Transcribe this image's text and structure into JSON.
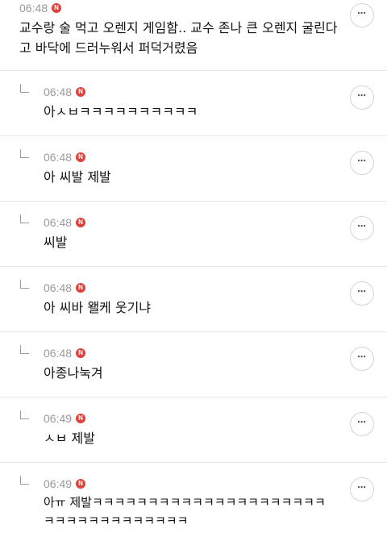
{
  "more_icon": "⋯",
  "badge_letter": "N",
  "colors": {
    "badge": "#e0413a",
    "time": "#9a9a9a",
    "divider": "#e8e8e8"
  },
  "comments": [
    {
      "time": "06:48",
      "text": "교수랑 술 먹고 오렌지 게임함.. 교수 존나 큰 오렌지 굴린다\n고 바닥에 드러누워서 퍼덕거렸음",
      "reply": false
    },
    {
      "time": "06:48",
      "text": "아ㅅㅂㅋㅋㅋㅋㅋㅋㅋㅋㅋㅋ",
      "reply": true
    },
    {
      "time": "06:48",
      "text": "아 씨발 제발",
      "reply": true
    },
    {
      "time": "06:48",
      "text": "씨발",
      "reply": true
    },
    {
      "time": "06:48",
      "text": "아 씨바 왤케 웃기냐",
      "reply": true
    },
    {
      "time": "06:48",
      "text": "아종나눅겨",
      "reply": true
    },
    {
      "time": "06:49",
      "text": "ㅅㅂ 제발",
      "reply": true
    },
    {
      "time": "06:49",
      "text": "아ㅠ 제발ㅋㅋㅋㅋㅋㅋㅋㅋㅋㅋㅋㅋㅋㅋㅋㅋㅋㅋㅋㅋㅋ\nㅋㅋㅋㅋㅋㅋㅋㅋㅋㅋㅋㅋㅋ",
      "reply": true
    }
  ]
}
